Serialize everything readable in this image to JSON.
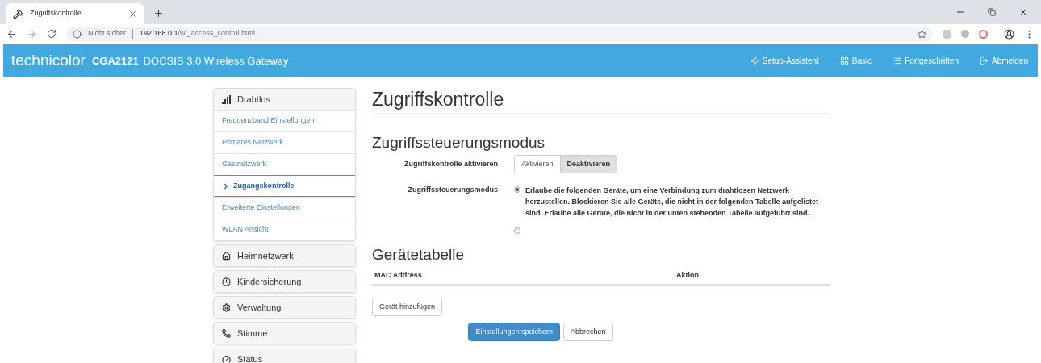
{
  "browser": {
    "tab_title": "Zugriffskontrolle",
    "security": "Nicht sicher",
    "url_host": "192.168.0.1",
    "url_path": "/wi_access_control.html"
  },
  "header": {
    "brand": "technicolor",
    "model": "CGA2121",
    "product": "DOCSIS 3.0 Wireless Gateway",
    "nav": [
      "Setup-Assistent",
      "Basic",
      "Fortgeschritten",
      "Abmelden"
    ]
  },
  "sidebar": {
    "groups": [
      {
        "label": "Drahtlos",
        "items": [
          {
            "label": "Frequenzband Einstellungen",
            "selected": false
          },
          {
            "label": "Primäres Netzwerk",
            "selected": false
          },
          {
            "label": "Gastnetzwerk",
            "selected": false
          },
          {
            "label": "Zugangskontrolle",
            "selected": true
          },
          {
            "label": "Erweiterte Einstellungen",
            "selected": false
          },
          {
            "label": "WLAN Ansicht",
            "selected": false
          }
        ]
      },
      {
        "label": "Heimnetzwerk"
      },
      {
        "label": "Kindersicherung"
      },
      {
        "label": "Verwaltung"
      },
      {
        "label": "Stimme"
      },
      {
        "label": "Status"
      }
    ]
  },
  "page_title": "Zugriffskontrolle",
  "section_title": "Zugriffssteuerungsmodus",
  "toggle": {
    "label": "Zugriffskontrolle aktivieren",
    "options": [
      {
        "label": "Aktivieren",
        "selected": false
      },
      {
        "label": "Deaktivieren",
        "selected": true
      }
    ]
  },
  "mode": {
    "label": "Zugriffssteuerungsmodus",
    "options": [
      {
        "text": "Erlaube die folgenden Geräte, um eine Verbindung zum drahtlosen Netzwerk herzustellen. Blockieren Sie alle Geräte, die nicht in der folgenden Tabelle aufgelistet sind. Erlaube alle Geräte, die nicht in der unten stehenden Tabelle aufgeführt sind.",
        "selected": true
      },
      {
        "selected": false
      }
    ]
  },
  "device_table": {
    "title": "Gerätetabelle",
    "columns": [
      "MAC Address",
      "Aktion"
    ],
    "add_button": "Gerät hinzufügen"
  },
  "actions": [
    {
      "label": "Einstellungen speichern",
      "kind": "primary"
    },
    {
      "label": "Abbrechen",
      "kind": "default"
    }
  ]
}
